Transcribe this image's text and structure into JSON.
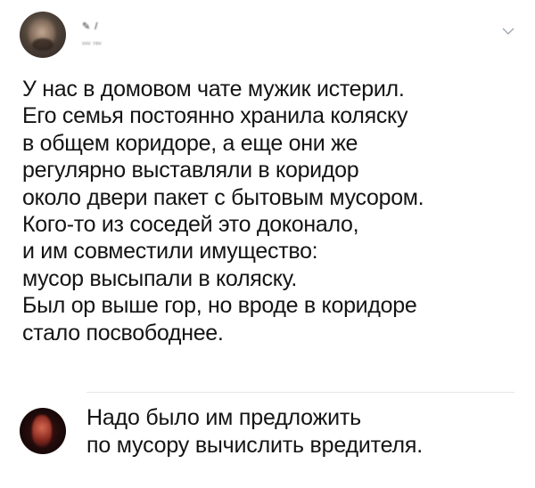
{
  "post": {
    "author": {
      "name": "✎ /",
      "handle": "ᵥᵥᵥ ᵣₑᵥ"
    },
    "menu_icon": "chevron-down-icon",
    "text_lines": [
      "У нас в домовом чате мужик истерил.",
      "Его семья постоянно хранила коляску",
      "в общем коридоре, а еще они же",
      "регулярно выставляли в коридор",
      "около двери пакет с бытовым мусором.",
      "Кого-то из соседей это доконало,",
      "и им совместили имущество:",
      "мусор высыпали в коляску.",
      "Был ор выше гор, но вроде в коридоре",
      "стало посвободнее."
    ]
  },
  "reply": {
    "text_lines": [
      "Надо было им предложить",
      "по мусору вычислить вредителя."
    ]
  },
  "colors": {
    "background": "#ffffff",
    "text": "#141414",
    "divider": "#e6e6e6",
    "chevron": "#9aa3ad"
  }
}
